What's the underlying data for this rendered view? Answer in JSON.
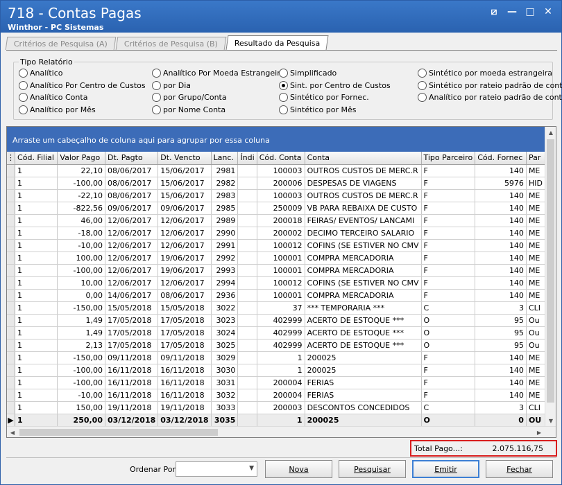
{
  "window": {
    "title": "718 - Contas Pagas",
    "subtitle": "Winthor - PC Sistemas",
    "controls": [
      "⧄",
      "—",
      "□",
      "✕"
    ]
  },
  "tabs": [
    {
      "label": "Critérios de Pesquisa (A)"
    },
    {
      "label": "Critérios de Pesquisa (B)"
    },
    {
      "label": "Resultado da Pesquisa"
    }
  ],
  "report_type": {
    "title": "Tipo Relatório",
    "options": [
      {
        "label": "Analítico",
        "selected": false
      },
      {
        "label": "Analítico Por Centro de Custos",
        "selected": false
      },
      {
        "label": "Analítico Conta",
        "selected": false
      },
      {
        "label": "Analítico por Mês",
        "selected": false
      },
      {
        "label": "Analítico Por Moeda Estrangeira",
        "selected": false
      },
      {
        "label": "por Dia",
        "selected": false
      },
      {
        "label": "por Grupo/Conta",
        "selected": false
      },
      {
        "label": "por Nome Conta",
        "selected": false
      },
      {
        "label": "Simplificado",
        "selected": false
      },
      {
        "label": "Sint. por Centro de Custos",
        "selected": true
      },
      {
        "label": "Sintético por Fornec.",
        "selected": false
      },
      {
        "label": "Sintético por Mês",
        "selected": false
      },
      {
        "label": "Sintético por moeda estrangeira",
        "selected": false
      },
      {
        "label": "Sintético por rateio padrão de conta",
        "selected": false
      },
      {
        "label": "Analítico por rateio padrão de conta",
        "selected": false
      }
    ]
  },
  "grid": {
    "group_hint": "Arraste um cabeçalho de coluna aqui para agrupar por essa coluna",
    "columns": [
      "Cód. Filial",
      "Valor Pago",
      "Dt. Pagto",
      "Dt. Vencto",
      "Lanc.",
      "Índi",
      "Cód. Conta",
      "Conta",
      "Tipo Parceiro",
      "Cód. Fornec",
      "Par"
    ],
    "rows": [
      [
        "1",
        "22,10",
        "08/06/2017",
        "15/06/2017",
        "2981",
        "",
        "100003",
        "OUTROS CUSTOS DE MERC.R",
        "F",
        "140",
        "ME"
      ],
      [
        "1",
        "-100,00",
        "08/06/2017",
        "15/06/2017",
        "2982",
        "",
        "200006",
        "DESPESAS DE VIAGENS",
        "F",
        "5976",
        "HID"
      ],
      [
        "1",
        "-22,10",
        "08/06/2017",
        "15/06/2017",
        "2983",
        "",
        "100003",
        "OUTROS CUSTOS DE MERC.R",
        "F",
        "140",
        "ME"
      ],
      [
        "1",
        "-822,56",
        "09/06/2017",
        "09/06/2017",
        "2985",
        "",
        "250009",
        "VB PARA REBAIXA DE CUSTO",
        "F",
        "140",
        "ME"
      ],
      [
        "1",
        "46,00",
        "12/06/2017",
        "12/06/2017",
        "2989",
        "",
        "200018",
        "FEIRAS/ EVENTOS/ LANCAMI",
        "F",
        "140",
        "ME"
      ],
      [
        "1",
        "-18,00",
        "12/06/2017",
        "12/06/2017",
        "2990",
        "",
        "200002",
        "DECIMO TERCEIRO SALARIO",
        "F",
        "140",
        "ME"
      ],
      [
        "1",
        "-10,00",
        "12/06/2017",
        "12/06/2017",
        "2991",
        "",
        "100012",
        "COFINS (SE ESTIVER NO CMV",
        "F",
        "140",
        "ME"
      ],
      [
        "1",
        "100,00",
        "12/06/2017",
        "19/06/2017",
        "2992",
        "",
        "100001",
        "COMPRA MERCADORIA",
        "F",
        "140",
        "ME"
      ],
      [
        "1",
        "-100,00",
        "12/06/2017",
        "19/06/2017",
        "2993",
        "",
        "100001",
        "COMPRA MERCADORIA",
        "F",
        "140",
        "ME"
      ],
      [
        "1",
        "10,00",
        "12/06/2017",
        "12/06/2017",
        "2994",
        "",
        "100012",
        "COFINS (SE ESTIVER NO CMV",
        "F",
        "140",
        "ME"
      ],
      [
        "1",
        "0,00",
        "14/06/2017",
        "08/06/2017",
        "2936",
        "",
        "100001",
        "COMPRA MERCADORIA",
        "F",
        "140",
        "ME"
      ],
      [
        "1",
        "-150,00",
        "15/05/2018",
        "15/05/2018",
        "3022",
        "",
        "37",
        "*** TEMPORARIA ***",
        "C",
        "3",
        "CLI"
      ],
      [
        "1",
        "1,49",
        "17/05/2018",
        "17/05/2018",
        "3023",
        "",
        "402999",
        "ACERTO DE ESTOQUE ***",
        "O",
        "95",
        "Ou"
      ],
      [
        "1",
        "1,49",
        "17/05/2018",
        "17/05/2018",
        "3024",
        "",
        "402999",
        "ACERTO DE ESTOQUE ***",
        "O",
        "95",
        "Ou"
      ],
      [
        "1",
        "2,13",
        "17/05/2018",
        "17/05/2018",
        "3025",
        "",
        "402999",
        "ACERTO DE ESTOQUE ***",
        "O",
        "95",
        "Ou"
      ],
      [
        "1",
        "-150,00",
        "09/11/2018",
        "09/11/2018",
        "3029",
        "",
        "1",
        "200025",
        "F",
        "140",
        "ME"
      ],
      [
        "1",
        "-100,00",
        "16/11/2018",
        "16/11/2018",
        "3030",
        "",
        "1",
        "200025",
        "F",
        "140",
        "ME"
      ],
      [
        "1",
        "-100,00",
        "16/11/2018",
        "16/11/2018",
        "3031",
        "",
        "200004",
        "FERIAS",
        "F",
        "140",
        "ME"
      ],
      [
        "1",
        "-10,00",
        "16/11/2018",
        "16/11/2018",
        "3032",
        "",
        "200004",
        "FERIAS",
        "F",
        "140",
        "ME"
      ],
      [
        "1",
        "150,00",
        "19/11/2018",
        "19/11/2018",
        "3033",
        "",
        "200003",
        "DESCONTOS CONCEDIDOS",
        "C",
        "3",
        "CLI"
      ]
    ],
    "total_row": [
      "1",
      "250,00",
      "03/12/2018",
      "03/12/2018",
      "3035",
      "",
      "1",
      "200025",
      "O",
      "0",
      "OU"
    ]
  },
  "total": {
    "label": "Total Pago...:",
    "value": "2.075.116,75"
  },
  "footer": {
    "order_label": "Ordenar Por:",
    "order_value": "",
    "buttons": [
      "Nova",
      "Pesquisar",
      "Emitir",
      "Fechar"
    ]
  }
}
